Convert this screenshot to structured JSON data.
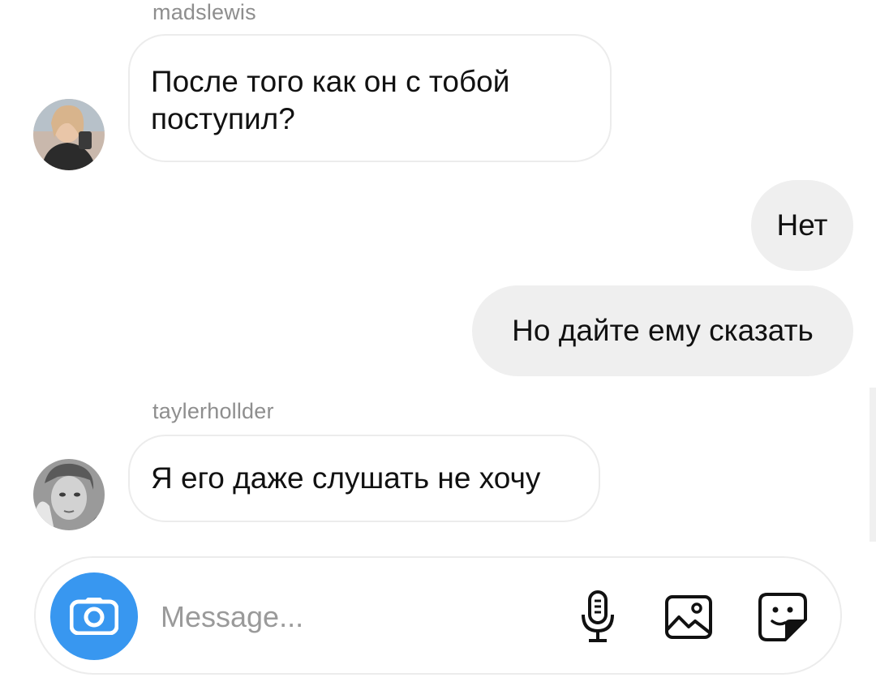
{
  "thread": {
    "messages": [
      {
        "sender": "madslewis",
        "direction": "incoming",
        "text": "После того как он с тобой поступил?"
      },
      {
        "sender": "me",
        "direction": "outgoing",
        "text": "Нет"
      },
      {
        "sender": "me",
        "direction": "outgoing",
        "text": "Но дайте ему сказать"
      },
      {
        "sender": "taylerhollder",
        "direction": "incoming",
        "text": "Я его даже слушать не хочу"
      }
    ]
  },
  "composer": {
    "placeholder": "Message...",
    "value": "",
    "icons": [
      "camera-icon",
      "microphone-icon",
      "image-icon",
      "sticker-icon"
    ],
    "accent_color": "#3897f0"
  },
  "colors": {
    "incoming_bubble_border": "#ececec",
    "outgoing_bubble": "#efefef",
    "sender_text": "#8e8e8e"
  }
}
